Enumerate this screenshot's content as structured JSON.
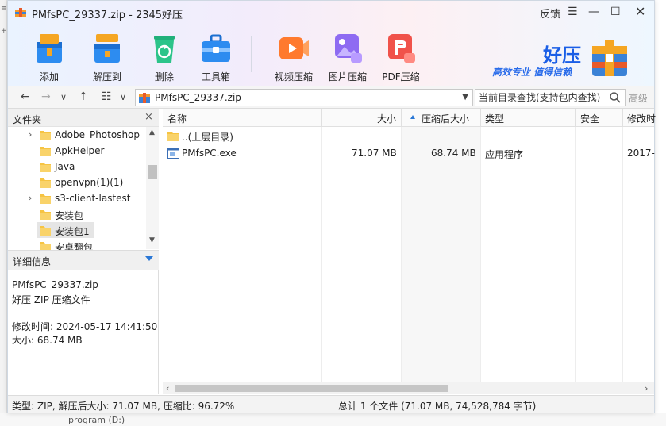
{
  "window": {
    "title": "PMfsPC_29337.zip - 2345好压",
    "feedback": "反馈",
    "menu_glyph": "☰",
    "minimize_glyph": "—",
    "maximize_glyph": "☐",
    "close_glyph": "✕"
  },
  "toolbar": {
    "add": "添加",
    "extract": "解压到",
    "delete": "删除",
    "toolbox": "工具箱",
    "video": "视频压缩",
    "image": "图片压缩",
    "pdf": "PDF压缩"
  },
  "brand": {
    "name": "好压",
    "slogan": "高效专业  值得信赖"
  },
  "nav": {
    "back": "←",
    "forward": "→",
    "down": "∨",
    "up": "↑",
    "view": "☷",
    "view_dd": "∨",
    "path": "PMfsPC_29337.zip",
    "search_placeholder": "当前目录查找(支持包内查找)",
    "advanced": "高级"
  },
  "folders": {
    "title": "文件夹",
    "close": "×",
    "items": [
      {
        "name": "Adobe_Photoshop_",
        "expand": "›"
      },
      {
        "name": "ApkHelper",
        "expand": ""
      },
      {
        "name": "Java",
        "expand": ""
      },
      {
        "name": "openvpn(1)(1)",
        "expand": ""
      },
      {
        "name": "s3-client-lastest",
        "expand": "›"
      },
      {
        "name": "安装包",
        "expand": ""
      },
      {
        "name": "安装包1",
        "expand": ""
      },
      {
        "name": "安卓翻包",
        "expand": ""
      }
    ],
    "scroll_up": "▲",
    "scroll_down": "▼"
  },
  "details": {
    "title": "详细信息",
    "filename": "PMfsPC_29337.zip",
    "filetype": "好压 ZIP 压缩文件",
    "modified": "修改时间: 2024-05-17 14:41:50",
    "size": "大小: 68.74 MB"
  },
  "list": {
    "headers": {
      "name": "名称",
      "size": "大小",
      "packed": "压缩后大小",
      "type": "类型",
      "security": "安全",
      "modified": "修改时"
    },
    "rows": [
      {
        "name": "..(上层目录)",
        "size": "",
        "packed": "",
        "type": "",
        "modified": ""
      },
      {
        "name": "PMfsPC.exe",
        "size": "71.07 MB",
        "packed": "68.74 MB",
        "type": "应用程序",
        "modified": "2017-"
      }
    ],
    "scroll_left": "‹",
    "scroll_right": "›"
  },
  "status": {
    "left": "类型: ZIP, 解压后大小: 71.07 MB, 压缩比: 96.72%",
    "right": "总计 1 个文件 (71.07 MB, 74,528,784 字节)"
  },
  "desktop": {
    "behind_text": "program (D:)",
    "edge_mark_1": "≡",
    "edge_mark_2": "+"
  },
  "colors": {
    "accent": "#2b78d6",
    "brand_blue": "#1a5ee6",
    "folder": "#f6c443"
  }
}
